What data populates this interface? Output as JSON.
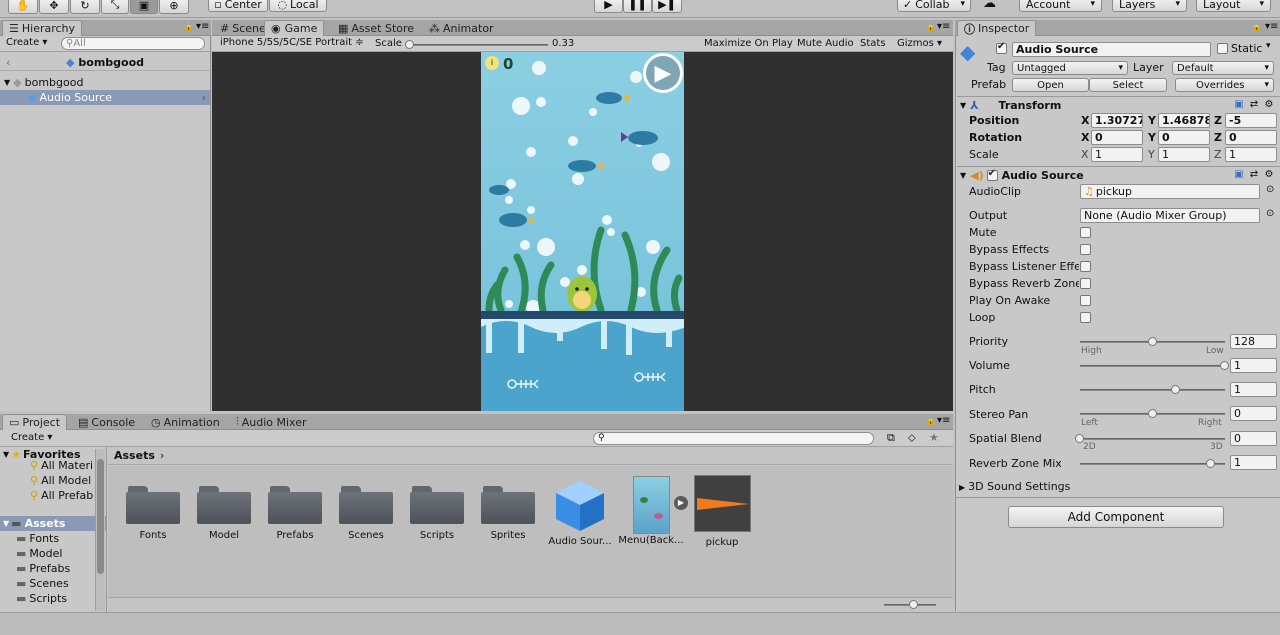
{
  "toolbar": {
    "pivot": "Center",
    "space": "Local",
    "collab": "Collab",
    "account": "Account",
    "layers": "Layers",
    "layout": "Layout",
    "transform_tools": [
      "hand-tool-icon",
      "move-tool-icon",
      "rotate-tool-icon",
      "scale-tool-icon",
      "rect-tool-icon",
      "transform-tool-icon"
    ]
  },
  "hierarchy": {
    "tab": "Hierarchy",
    "create": "Create",
    "search_placeholder": "All",
    "scene": "bombgood",
    "items": [
      {
        "label": "Audio Source"
      }
    ]
  },
  "scene_tabs": {
    "scene": "Scene",
    "game": "Game",
    "asset_store": "Asset Store",
    "animator": "Animator"
  },
  "game_bar": {
    "resolution": "iPhone 5/5S/5C/SE Portrait",
    "scale_label": "Scale",
    "scale_value": "0.33",
    "maximize": "Maximize On Play",
    "mute": "Mute Audio",
    "stats": "Stats",
    "gizmos": "Gizmos"
  },
  "game_view": {
    "score": "0"
  },
  "project": {
    "tabs": {
      "project": "Project",
      "console": "Console",
      "animation": "Animation",
      "audio_mixer": "Audio Mixer"
    },
    "create": "Create",
    "favorites": {
      "title": "Favorites",
      "items": [
        "All Materi",
        "All Model",
        "All Prefab"
      ]
    },
    "assets_tree": {
      "title": "Assets",
      "items": [
        "Fonts",
        "Model",
        "Prefabs",
        "Scenes",
        "Scripts"
      ]
    },
    "breadcrumb": "Assets",
    "assets": [
      {
        "name": "Fonts",
        "kind": "folder"
      },
      {
        "name": "Model",
        "kind": "folder"
      },
      {
        "name": "Prefabs",
        "kind": "folder"
      },
      {
        "name": "Scenes",
        "kind": "folder"
      },
      {
        "name": "Scripts",
        "kind": "folder"
      },
      {
        "name": "Sprites",
        "kind": "folder"
      },
      {
        "name": "Audio Sour...",
        "kind": "prefab"
      },
      {
        "name": "Menu(Back...",
        "kind": "image"
      },
      {
        "name": "pickup",
        "kind": "audio"
      }
    ]
  },
  "inspector": {
    "tab": "Inspector",
    "object": {
      "name": "Audio Source",
      "static_label": "Static",
      "tag_label": "Tag",
      "tag_value": "Untagged",
      "layer_label": "Layer",
      "layer_value": "Default",
      "prefab_label": "Prefab",
      "open": "Open",
      "select": "Select",
      "overrides": "Overrides"
    },
    "transform": {
      "title": "Transform",
      "position": {
        "label": "Position",
        "x": "1.30727",
        "y": "1.46878",
        "z": "-5"
      },
      "rotation": {
        "label": "Rotation",
        "x": "0",
        "y": "0",
        "z": "0"
      },
      "scale": {
        "label": "Scale",
        "x": "1",
        "y": "1",
        "z": "1"
      },
      "axis": {
        "x": "X",
        "y": "Y",
        "z": "Z"
      }
    },
    "audio_source": {
      "title": "Audio Source",
      "audioclip_label": "AudioClip",
      "audioclip_value": "pickup",
      "output_label": "Output",
      "output_value": "None (Audio Mixer Group)",
      "toggles": [
        {
          "label": "Mute",
          "checked": false
        },
        {
          "label": "Bypass Effects",
          "checked": false
        },
        {
          "label": "Bypass Listener Effe",
          "checked": false
        },
        {
          "label": "Bypass Reverb Zone",
          "checked": false
        },
        {
          "label": "Play On Awake",
          "checked": false
        },
        {
          "label": "Loop",
          "checked": false
        }
      ],
      "priority": {
        "label": "Priority",
        "value": "128",
        "level": 0.5,
        "min_label": "High",
        "max_label": "Low"
      },
      "volume": {
        "label": "Volume",
        "value": "1",
        "level": 1
      },
      "pitch": {
        "label": "Pitch",
        "value": "1",
        "level": 0.66
      },
      "stereo_pan": {
        "label": "Stereo Pan",
        "value": "0",
        "level": 0.5,
        "min_label": "Left",
        "max_label": "Right"
      },
      "spatial_blend": {
        "label": "Spatial Blend",
        "value": "0",
        "level": 0,
        "min_label": "2D",
        "max_label": "3D"
      },
      "reverb_zone_mix": {
        "label": "Reverb Zone Mix",
        "value": "1",
        "level": 0.9
      },
      "sound_settings": "3D Sound Settings"
    },
    "add_component": "Add Component"
  }
}
